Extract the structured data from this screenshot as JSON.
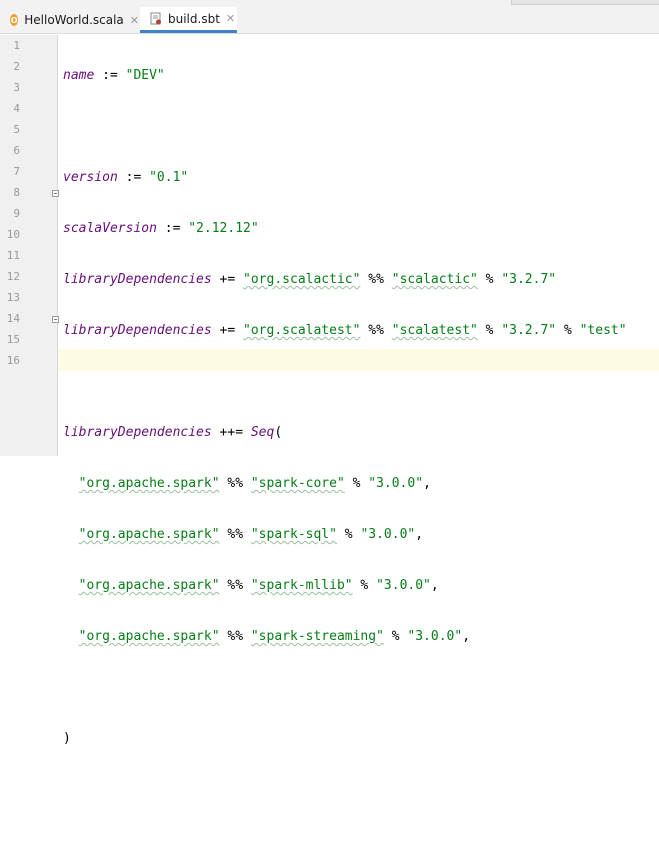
{
  "tabs": [
    {
      "label": "HelloWorld.scala",
      "icon": "scala-file-icon",
      "active": false
    },
    {
      "label": "build.sbt",
      "icon": "sbt-file-icon",
      "active": true
    }
  ],
  "close_glyph": "✕",
  "gutter": {
    "line_numbers": [
      "1",
      "2",
      "3",
      "4",
      "5",
      "6",
      "7",
      "8",
      "9",
      "10",
      "11",
      "12",
      "13",
      "14",
      "15",
      "16"
    ]
  },
  "code": {
    "l1": {
      "id": "name",
      "op": " := ",
      "s1": "\"DEV\""
    },
    "l3": {
      "id": "version",
      "op": " := ",
      "s1": "\"0.1\""
    },
    "l4": {
      "id": "scalaVersion",
      "op": " := ",
      "s1": "\"2.12.12\""
    },
    "l5": {
      "id": "libraryDependencies",
      "op": " += ",
      "s1": "\"org.scalactic\"",
      "op2": " %% ",
      "s2": "\"scalactic\"",
      "op3": " % ",
      "s3": "\"3.2.7\""
    },
    "l6": {
      "id": "libraryDependencies",
      "op": " += ",
      "s1": "\"org.scalatest\"",
      "op2": " %% ",
      "s2": "\"scalatest\"",
      "op3": " % ",
      "s3": "\"3.2.7\"",
      "op4": " % ",
      "s4": "\"test\""
    },
    "l8": {
      "id": "libraryDependencies",
      "op": " ++= ",
      "kw2": "Seq",
      "paren": "("
    },
    "l9": {
      "s1": "\"org.apache.spark\"",
      "op2": " %% ",
      "s2": "\"spark-core\"",
      "op3": " % ",
      "s3": "\"3.0.0\"",
      "tail": ","
    },
    "l10": {
      "s1": "\"org.apache.spark\"",
      "op2": " %% ",
      "s2": "\"spark-sql\"",
      "op3": " % ",
      "s3": "\"3.0.0\"",
      "tail": ","
    },
    "l11": {
      "s1": "\"org.apache.spark\"",
      "op2": " %% ",
      "s2": "\"spark-mllib\"",
      "op3": " % ",
      "s3": "\"3.0.0\"",
      "tail": ","
    },
    "l12": {
      "s1": "\"org.apache.spark\"",
      "op2": " %% ",
      "s2": "\"spark-streaming\"",
      "op3": " % ",
      "s3": "\"3.0.0\"",
      "tail": ","
    },
    "l14": {
      "paren": ")"
    }
  },
  "colors": {
    "keyword": "#660e7a",
    "string": "#067d17",
    "active_tab_underline": "#4083c9",
    "current_line": "#fdfbe2"
  }
}
